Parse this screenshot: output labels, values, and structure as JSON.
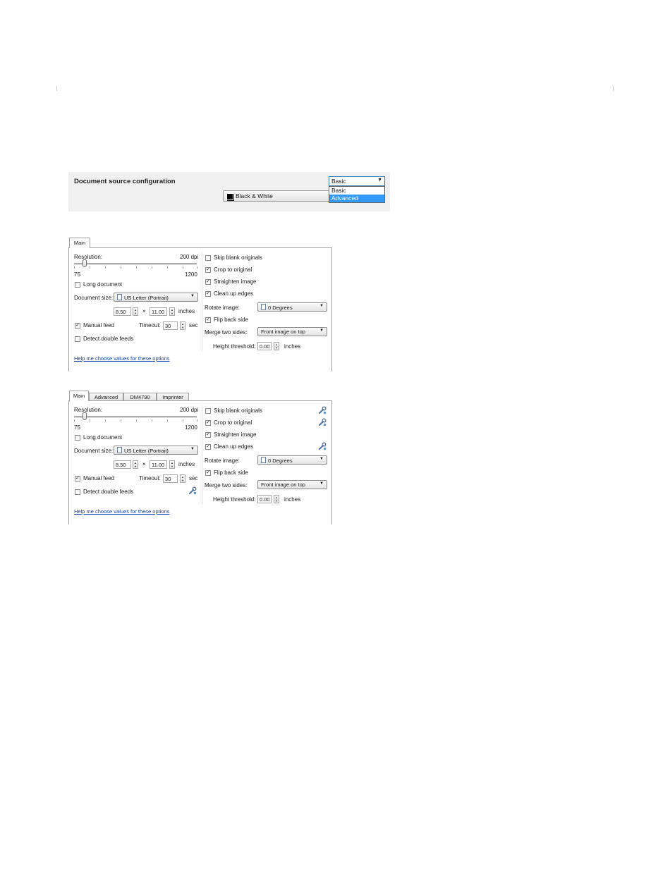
{
  "config": {
    "title": "Document source configuration",
    "mode_selected": "Basic",
    "mode_options": [
      "Basic",
      "Advanced"
    ],
    "color_mode": "Black & White"
  },
  "basic_panel": {
    "tabs": [
      "Main"
    ]
  },
  "advanced_panel": {
    "tabs": [
      "Main",
      "Advanced",
      "DM4790",
      "Imprinter"
    ]
  },
  "main": {
    "resolution_label": "Resolution:",
    "resolution_value": "200 dpi",
    "resolution_min": "75",
    "resolution_max": "1200",
    "long_document": "Long document",
    "document_size_label": "Document size:",
    "document_size_value": "US Letter (Portrait)",
    "width_value": "8.50",
    "times": "×",
    "height_value": "11.00",
    "size_units": "inches",
    "manual_feed": "Manual feed",
    "timeout_label": "Timeout:",
    "timeout_value": "30",
    "timeout_units": "sec",
    "detect_double_feeds": "Detect double feeds",
    "help_link": "Help me choose values for these options",
    "skip_blank": "Skip blank originals",
    "crop_to_original": "Crop to original",
    "straighten_image": "Straighten image",
    "clean_up_edges": "Clean up edges",
    "rotate_label": "Rotate image:",
    "rotate_value": "0 Degrees",
    "flip_back_side": "Flip back side",
    "merge_label": "Merge two sides:",
    "merge_value": "Front image on top",
    "height_threshold_label": "Height threshold:",
    "height_threshold_value": "0.00",
    "height_threshold_units": "inches",
    "check_mark": "✓"
  },
  "resolution_level": 0.087
}
